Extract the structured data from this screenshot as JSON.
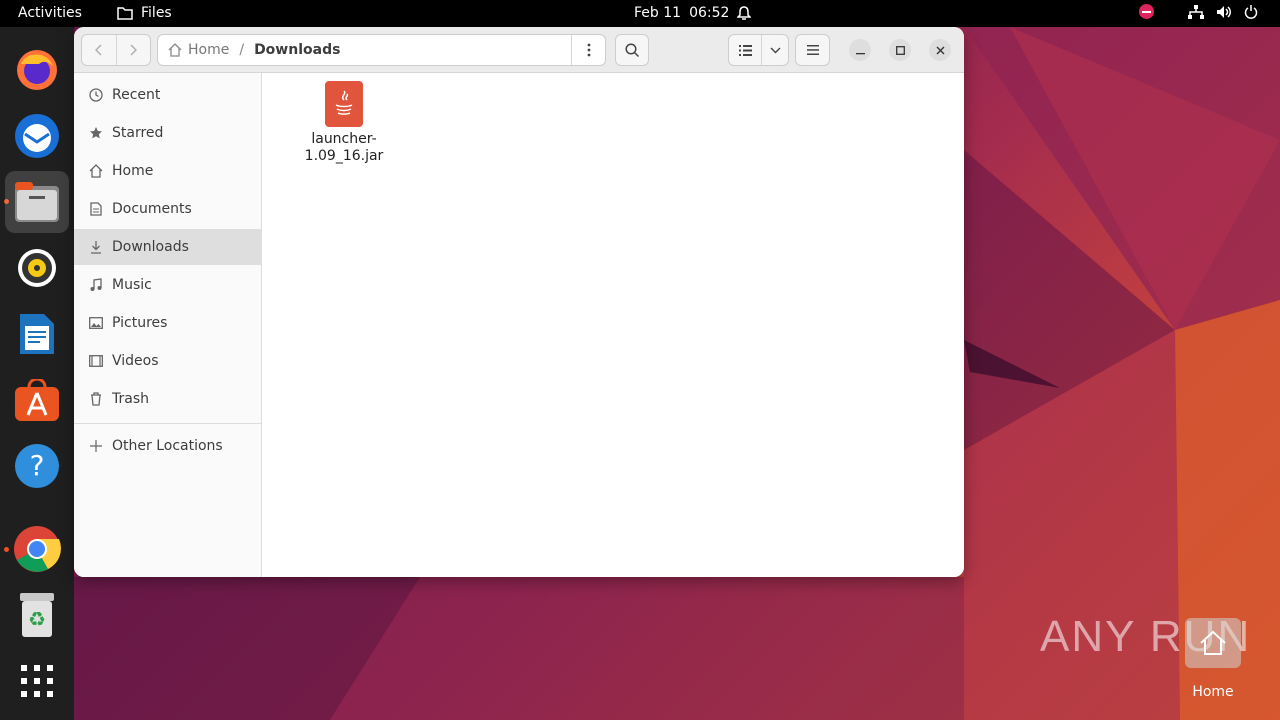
{
  "topbar": {
    "activities": "Activities",
    "app_name": "Files",
    "date": "Feb 11",
    "time": "06:52"
  },
  "window": {
    "path": {
      "home_label": "Home",
      "separator": "/",
      "current": "Downloads"
    },
    "sidebar": {
      "items": [
        {
          "label": "Recent",
          "icon": "clock-icon"
        },
        {
          "label": "Starred",
          "icon": "star-icon"
        },
        {
          "label": "Home",
          "icon": "home-icon"
        },
        {
          "label": "Documents",
          "icon": "document-icon"
        },
        {
          "label": "Downloads",
          "icon": "download-icon",
          "selected": true
        },
        {
          "label": "Music",
          "icon": "music-icon"
        },
        {
          "label": "Pictures",
          "icon": "picture-icon"
        },
        {
          "label": "Videos",
          "icon": "video-icon"
        },
        {
          "label": "Trash",
          "icon": "trash-icon"
        }
      ],
      "other_locations": "Other Locations"
    },
    "files": [
      {
        "name_line1": "launcher-",
        "name_line2": "1.09_16.jar",
        "icon": "java-icon"
      }
    ]
  },
  "desktop": {
    "home_label": "Home",
    "watermark": "ANY RUN"
  },
  "colors": {
    "accent": "#e95420",
    "java_icon": "#e2553d"
  }
}
